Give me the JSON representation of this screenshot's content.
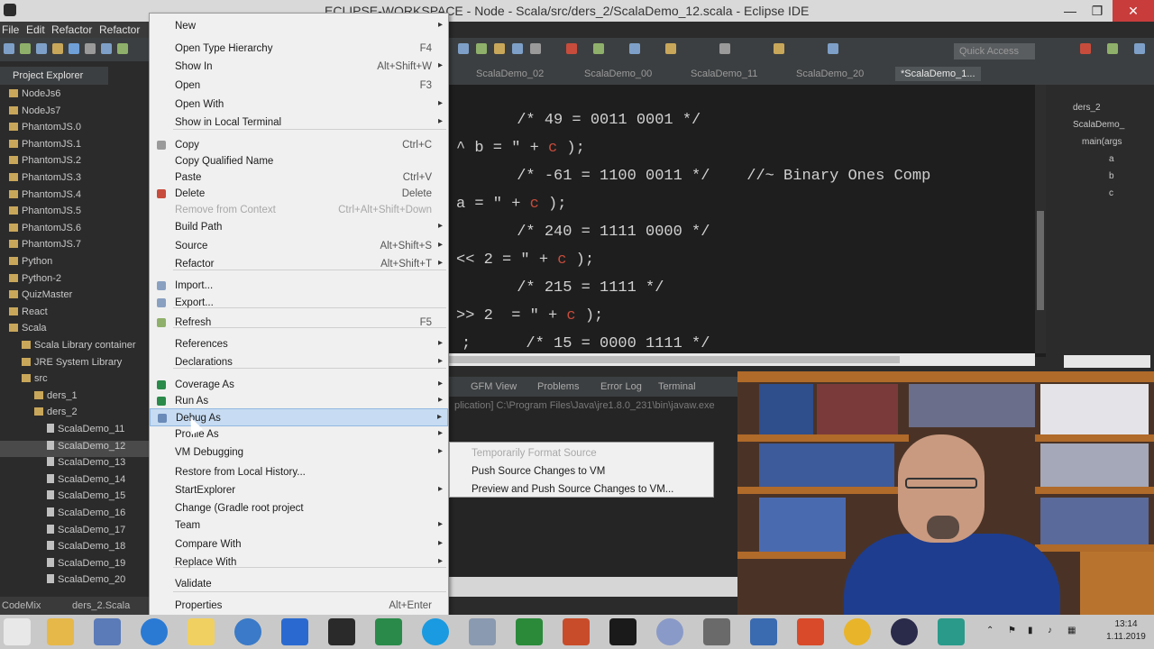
{
  "window": {
    "title": "ECLIPSE-WORKSPACE - Node - Scala/src/ders_2/ScalaDemo_12.scala - Eclipse IDE",
    "minimize": "—",
    "restore": "❐",
    "close": "✕"
  },
  "menubar": [
    "File",
    "Edit",
    "Refactor",
    "Refactor"
  ],
  "explorer": {
    "tab_label": "Project Explorer",
    "items": [
      "NodeJs6",
      "NodeJs7",
      "PhantomJS.0",
      "PhantomJS.1",
      "PhantomJS.2",
      "PhantomJS.3",
      "PhantomJS.4",
      "PhantomJS.5",
      "PhantomJS.6",
      "PhantomJS.7",
      "Python",
      "Python-2",
      "QuizMaster",
      "React",
      "Scala",
      "Scala Library container",
      "JRE System Library",
      "src",
      "ders_1",
      "ders_2",
      "ScalaDemo_11",
      "ScalaDemo_12",
      "ScalaDemo_13",
      "ScalaDemo_14",
      "ScalaDemo_15",
      "ScalaDemo_16",
      "ScalaDemo_17",
      "ScalaDemo_18",
      "ScalaDemo_19",
      "ScalaDemo_20"
    ],
    "bottom_tabs": [
      "CodeMix",
      "ders_2.Scala"
    ]
  },
  "toolbar": {
    "quick_access": "Quick Access"
  },
  "editor": {
    "tabs": [
      "ScalaDemo_02",
      "ScalaDemo_00",
      "ScalaDemo_11",
      "ScalaDemo_20",
      "*ScalaDemo_1..."
    ],
    "lines": [
      {
        "code": "      /* 49 = 0011 0001 */",
        "var": ""
      },
      {
        "code": "^ b = \" + ",
        "var": "c",
        "tail": " );"
      },
      {
        "code": "      /* -61 = 1100 0011 */    //~ Binary Ones Comp",
        "var": ""
      },
      {
        "code": "a = \" + ",
        "var": "c",
        "tail": " );"
      },
      {
        "code": "      /* 240 = 1111 0000 */",
        "var": ""
      },
      {
        "code": "<< 2 = \" + ",
        "var": "c",
        "tail": " );"
      },
      {
        "code": "      /* 215 = 1111 */",
        "var": ""
      },
      {
        "code": ">> 2  = \" + ",
        "var": "c",
        "tail": " );"
      },
      {
        "code": ";      /* 15 = 0000 1111 */",
        "var": ""
      }
    ]
  },
  "outline": {
    "items": [
      "ders_2",
      "ScalaDemo_",
      "main(args",
      "a",
      "b",
      "c"
    ]
  },
  "console": {
    "tabs": [
      "GFM View",
      "Problems",
      "Error Log",
      "Terminal"
    ],
    "path": "plication] C:\\Program Files\\Java\\jre1.8.0_231\\bin\\javaw.exe"
  },
  "context_menu": {
    "items": [
      {
        "label": "New",
        "shortcut": "",
        "submenu": true
      },
      {
        "label": "Open Type Hierarchy",
        "shortcut": "F4"
      },
      {
        "label": "Show In",
        "shortcut": "Alt+Shift+W",
        "submenu": true
      },
      {
        "label": "Open",
        "shortcut": "F3"
      },
      {
        "label": "Open With",
        "shortcut": "",
        "submenu": true
      },
      {
        "label": "Show in Local Terminal",
        "shortcut": "",
        "submenu": true
      },
      {
        "label": "Copy",
        "shortcut": "Ctrl+C"
      },
      {
        "label": "Copy Qualified Name",
        "shortcut": ""
      },
      {
        "label": "Paste",
        "shortcut": "Ctrl+V"
      },
      {
        "label": "Delete",
        "shortcut": "Delete"
      },
      {
        "label": "Remove from Context",
        "shortcut": "Ctrl+Alt+Shift+Down",
        "disabled": true
      },
      {
        "label": "Build Path",
        "shortcut": "",
        "submenu": true
      },
      {
        "label": "Source",
        "shortcut": "Alt+Shift+S",
        "submenu": true
      },
      {
        "label": "Refactor",
        "shortcut": "Alt+Shift+T",
        "submenu": true
      },
      {
        "label": "Import...",
        "shortcut": ""
      },
      {
        "label": "Export...",
        "shortcut": ""
      },
      {
        "label": "Refresh",
        "shortcut": "F5"
      },
      {
        "label": "References",
        "shortcut": "",
        "submenu": true
      },
      {
        "label": "Declarations",
        "shortcut": "",
        "submenu": true
      },
      {
        "label": "Coverage As",
        "shortcut": "",
        "submenu": true
      },
      {
        "label": "Run As",
        "shortcut": "",
        "submenu": true
      },
      {
        "label": "Debug As",
        "shortcut": "",
        "submenu": true
      },
      {
        "label": "Profile As",
        "shortcut": "",
        "submenu": true
      },
      {
        "label": "VM Debugging",
        "shortcut": "",
        "submenu": true
      },
      {
        "label": "Restore from Local History...",
        "shortcut": ""
      },
      {
        "label": "StartExplorer",
        "shortcut": "",
        "submenu": true
      },
      {
        "label": "Change (Gradle root project",
        "shortcut": ""
      },
      {
        "label": "Team",
        "shortcut": "",
        "submenu": true
      },
      {
        "label": "Compare With",
        "shortcut": "",
        "submenu": true
      },
      {
        "label": "Replace With",
        "shortcut": "",
        "submenu": true
      },
      {
        "label": "Validate",
        "shortcut": ""
      },
      {
        "label": "Properties",
        "shortcut": "Alt+Enter"
      }
    ]
  },
  "submenu": {
    "items": [
      {
        "label": "Temporarily Format Source",
        "disabled": true
      },
      {
        "label": "Push Source Changes to VM",
        "disabled": false
      },
      {
        "label": "Preview and Push Source Changes to VM...",
        "disabled": false
      }
    ]
  },
  "taskbar": {
    "clock_time": "13:14",
    "clock_date": "1.11.2019"
  },
  "colors": {
    "accent_highlight": "#c7dcf2",
    "string_var": "#c84c3c",
    "editor_bg": "#1e1e1e"
  }
}
